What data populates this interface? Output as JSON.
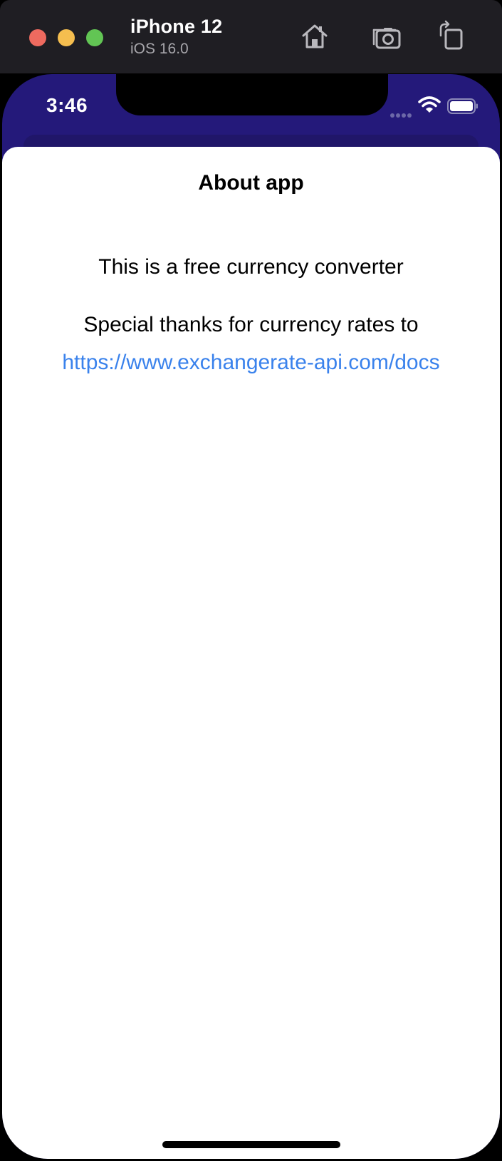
{
  "simulator": {
    "device_name": "iPhone 12",
    "os_version": "iOS 16.0",
    "toolbar_icons": [
      "home-icon",
      "screenshot-icon",
      "rotate-icon"
    ],
    "traffic_light_colors": [
      "#ee6a5f",
      "#f5be4f",
      "#62c554"
    ]
  },
  "status_bar": {
    "time": "3:46",
    "icons": [
      "cellular-signal-icon",
      "wifi-icon",
      "battery-icon"
    ]
  },
  "sheet": {
    "title": "About app",
    "description": "This is a free currency converter",
    "thanks": "Special thanks for currency rates to",
    "link": "https://www.exchangerate-api.com/docs"
  },
  "colors": {
    "header_background": "#24197a",
    "link": "#3a82ec",
    "sheet_background": "#ffffff"
  }
}
